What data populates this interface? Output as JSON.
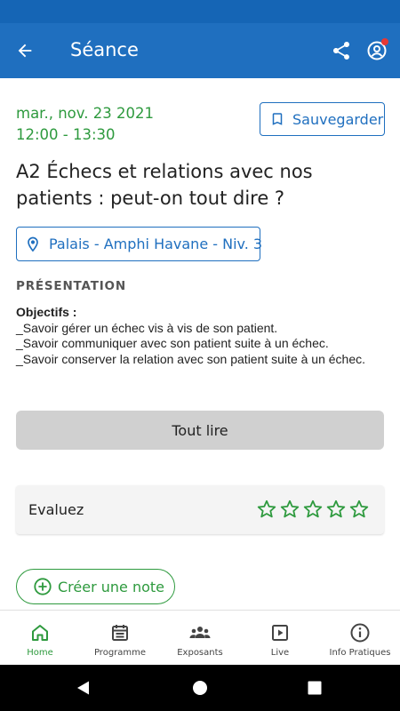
{
  "appbar": {
    "title": "Séance",
    "icons": [
      "arrow-back-icon",
      "share-icon",
      "account-icon"
    ],
    "notification_color": "#e53935"
  },
  "session": {
    "date": "mar., nov. 23 2021",
    "time": "12:00 - 13:30",
    "save_label": "Sauvegarder",
    "title": "A2 Échecs et relations avec nos patients : peut-on tout dire ?",
    "location": "Palais - Amphi Havane - Niv. 3"
  },
  "presentation": {
    "section_label": "PRÉSENTATION",
    "heading": "Objectifs :",
    "lines": [
      "_Savoir gérer un échec vis à vis de son patient.",
      "_Savoir communiquer avec son patient suite à un échec.",
      "_Savoir conserver la relation avec son patient suite à un échec."
    ],
    "read_all_label": "Tout lire"
  },
  "rating": {
    "label": "Evaluez",
    "stars_filled": 0,
    "stars_total": 5
  },
  "note": {
    "label": "Créer une note"
  },
  "bottom_nav": {
    "items": [
      {
        "label": "Home",
        "icon": "home-icon",
        "active": true
      },
      {
        "label": "Programme",
        "icon": "calendar-icon",
        "active": false
      },
      {
        "label": "Exposants",
        "icon": "people-icon",
        "active": false
      },
      {
        "label": "Live",
        "icon": "play-icon",
        "active": false
      },
      {
        "label": "Info Pratiques",
        "icon": "info-icon",
        "active": false
      }
    ]
  },
  "colors": {
    "primary": "#1f6fbf",
    "accent_green": "#2e9a3e",
    "button_grey": "#d0d0d0"
  }
}
